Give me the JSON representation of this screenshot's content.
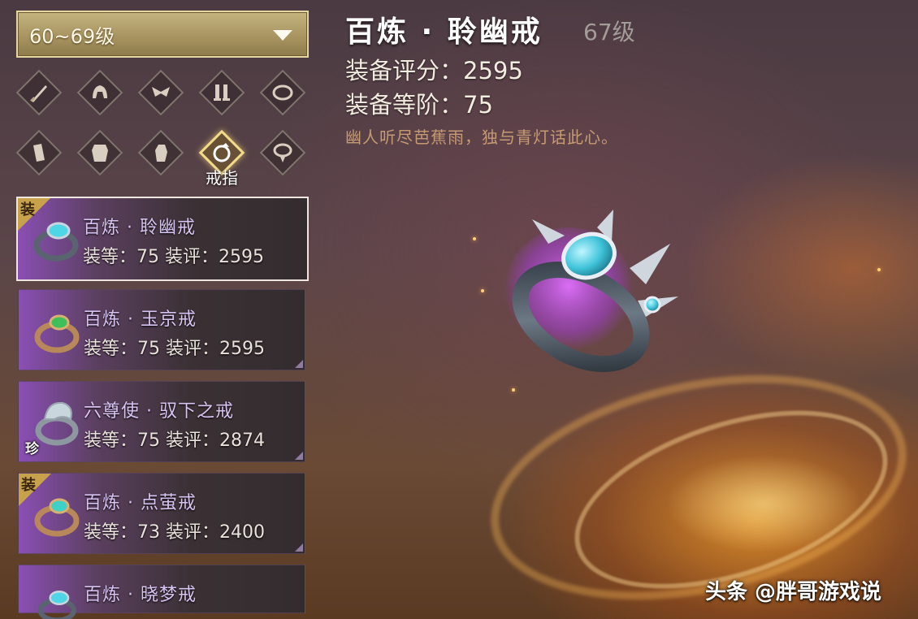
{
  "filter": {
    "level_range": "60~69级"
  },
  "slots": [
    {
      "icon": "sword-icon"
    },
    {
      "icon": "helmet-icon"
    },
    {
      "icon": "shoulder-icon"
    },
    {
      "icon": "boots-icon"
    },
    {
      "icon": "bracelet-icon"
    },
    {
      "icon": "armguard-icon"
    },
    {
      "icon": "armor-icon"
    },
    {
      "icon": "glove-icon"
    },
    {
      "icon": "ring-icon",
      "label": "戒指",
      "active": true
    },
    {
      "icon": "necklace-icon"
    }
  ],
  "items": [
    {
      "name": "百炼 · 聆幽戒",
      "stats": "装等：75 装评：2595",
      "tag": "装",
      "selected": true,
      "gem": "#4fd6e6",
      "band": "#5a6470"
    },
    {
      "name": "百炼 · 玉京戒",
      "stats": "装等：75 装评：2595",
      "tag": "",
      "gem": "#3fbf5a",
      "band": "#b8875a"
    },
    {
      "name": "六尊使 · 驭下之戒",
      "stats": "装等：75 装评：2874",
      "tag": "",
      "badge": "珍",
      "gem": "#c9d6de",
      "band": "#8d97a0"
    },
    {
      "name": "百炼 · 点萤戒",
      "stats": "装等：73 装评：2400",
      "tag": "装",
      "gem": "#3fd0c8",
      "band": "#b8875a"
    },
    {
      "name": "百炼 · 晓梦戒",
      "stats": "",
      "tag": "",
      "gem": "#4fd6e6",
      "band": "#5a6470"
    }
  ],
  "detail": {
    "title": "百炼 · 聆幽戒",
    "level": "67级",
    "score_label": "装备评分：",
    "score": "2595",
    "tier_label": "装备等阶：",
    "tier": "75",
    "flavor": "幽人听尽芭蕉雨，独与青灯话此心。"
  },
  "watermark": "头条 @胖哥游戏说",
  "colors": {
    "accent_gold": "#c6b47f",
    "rare_purple": "#8a4fb4",
    "gem_cyan": "#4fd6e6"
  }
}
